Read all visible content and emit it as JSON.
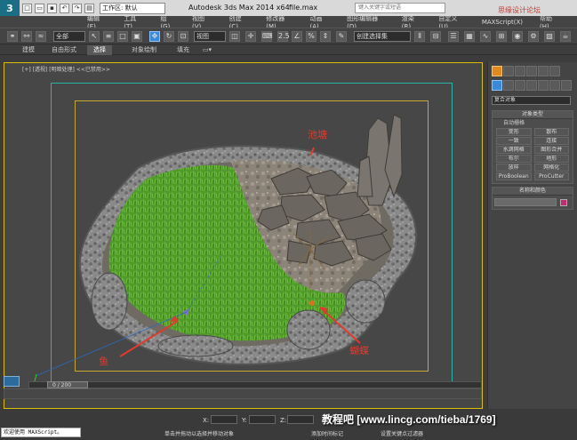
{
  "titlebar": {
    "logo": "3",
    "workspace": "工作区: 默认",
    "app_title": "Autodesk 3ds Max  2014 x64",
    "file_name": "file.max",
    "search_placeholder": "键入关键字或短语",
    "site_watermark": "思缘设计论坛"
  },
  "menu": {
    "items": [
      "编辑(E)",
      "工具(T)",
      "组(G)",
      "视图(V)",
      "创建(C)",
      "修改器(M)",
      "动画(A)",
      "图形编辑器(D)",
      "渲染(R)",
      "自定义(U)",
      "MAXScript(X)",
      "帮助(H)"
    ]
  },
  "toolbar": {
    "filter_value": "全部",
    "coord_value": "视图",
    "named_sel_value": "创建选择集",
    "snap_label": "2.5"
  },
  "ribbon": {
    "tabs": [
      "建模",
      "自由形式",
      "选择",
      "对象绘制",
      "填充"
    ],
    "active_index": 2
  },
  "viewport": {
    "label": "[+] [透视] [明暗处理] <<已禁用>>",
    "annotations": {
      "pond": "池塘",
      "fish": "鱼",
      "butterfly": "蝴蝶"
    }
  },
  "command_panel": {
    "category_value": "复合对象",
    "object_type_header": "对象类型",
    "autogrid_label": "自动栅格",
    "buttons": [
      "变形",
      "散布",
      "一致",
      "连接",
      "水滴网格",
      "图形合并",
      "布尔",
      "地形",
      "放样",
      "网格化",
      "ProBoolean",
      "ProCutter"
    ],
    "name_color_header": "名称和颜色",
    "swatch_color": "#c22b6d"
  },
  "timeline": {
    "frame_counter": "0 / 200"
  },
  "status": {
    "maxscript_text": "欢迎使用 MAXScript。",
    "prompt": "单击并拖动以选择并移动对象",
    "coord_x": "X:",
    "coord_y": "Y:",
    "coord_z": "Z:",
    "add_tag": "添加时间标记",
    "set_key": "设置关键点过滤器",
    "bottom_watermark": "教程吧 [www.lincg.com/tieba/1769]"
  }
}
